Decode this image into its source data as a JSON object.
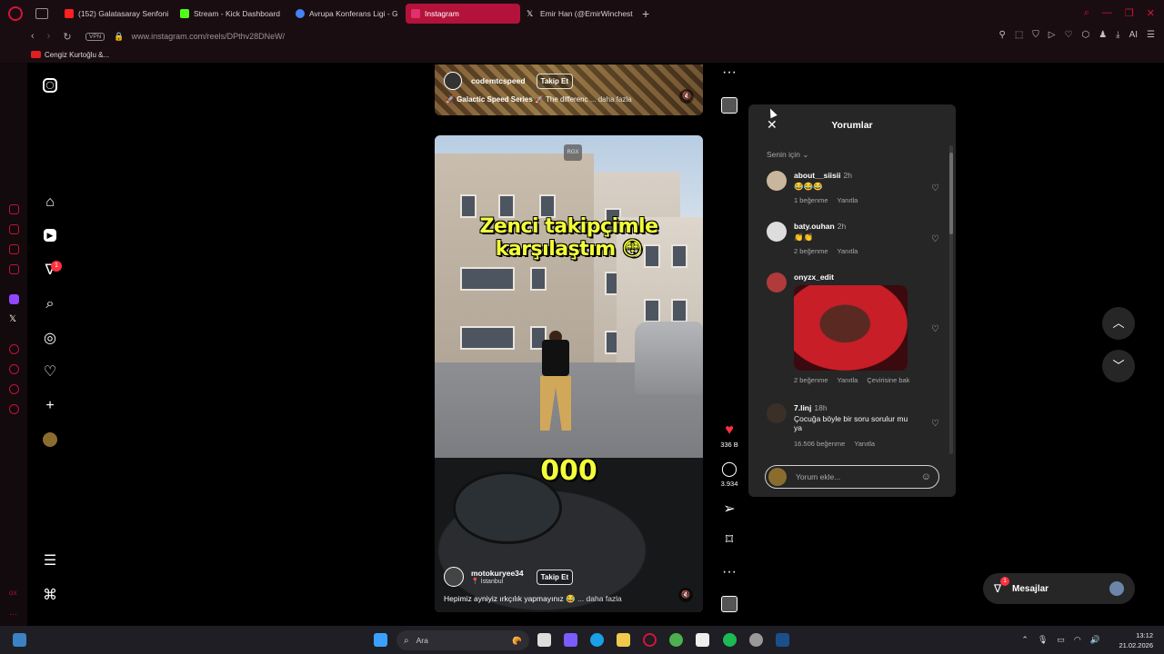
{
  "tabs": [
    {
      "label": "(152) Galatasaray Senfoni",
      "icon_color": "#ff2020"
    },
    {
      "label": "Stream - Kick Dashboard",
      "icon_color": "#53fc18"
    },
    {
      "label": "Avrupa Konferans Ligi - G",
      "icon_color": "#4285f4"
    },
    {
      "label": "Instagram",
      "icon_color": "#e1306c",
      "active": true
    },
    {
      "label": "Emir Han (@EmirWinchest",
      "icon_color": "#ffffff"
    }
  ],
  "address": {
    "vpn": "VPN",
    "url": "www.instagram.com/reels/DPthv28DNeW/",
    "ai": "AI"
  },
  "bookmark": {
    "label": "Cengiz Kurtoğlu &..."
  },
  "sidebar": {
    "notif_count": "1"
  },
  "top_reel": {
    "username": "codemtcspeed",
    "follow": "Takip Et",
    "caption_bold": "🚀 Galactic Speed Series 🚀",
    "caption": "The differenc",
    "more": "... daha fazla"
  },
  "reel": {
    "watermark": "RGX",
    "overlay_title": "Zenci takipçimle karşılaştım 😳",
    "overlay_number": "000",
    "username": "motokuryee34",
    "location": "İstanbul",
    "follow": "Takip Et",
    "caption": "Hepimiz ayniyiz ırkçılık yapmayınız 😂",
    "more": "... daha fazla"
  },
  "actions": {
    "likes": "336 B",
    "comments": "3.934"
  },
  "comments_panel": {
    "title": "Yorumlar",
    "sort": "Senin için",
    "input_placeholder": "Yorum ekle...",
    "items": [
      {
        "user": "about__siisii",
        "time": "2h",
        "text": "😂😂😂",
        "likes": "1 beğenme",
        "reply": "Yanıtla"
      },
      {
        "user": "baty.ouhan",
        "time": "2h",
        "text": "👏👏",
        "likes": "2 beğenme",
        "reply": "Yanıtla"
      },
      {
        "user": "onyzx_edit",
        "time": "",
        "text": "",
        "likes": "2 beğenme",
        "reply": "Yanıtla",
        "translate": "Çevirisine bak"
      },
      {
        "user": "7.linj",
        "time": "18h",
        "text": "Çocuğa böyle bir soru sorulur mu ya",
        "likes": "16.506 beğenme",
        "reply": "Yanıtla"
      }
    ]
  },
  "messages": {
    "label": "Mesajlar",
    "badge": "1"
  },
  "taskbar": {
    "search": "Ara",
    "time": "13:12",
    "date": "21.02.2026"
  },
  "colors": {
    "accent": "#b3123a",
    "like_red": "#ff3040",
    "overlay_yellow": "#f3ff3a"
  }
}
